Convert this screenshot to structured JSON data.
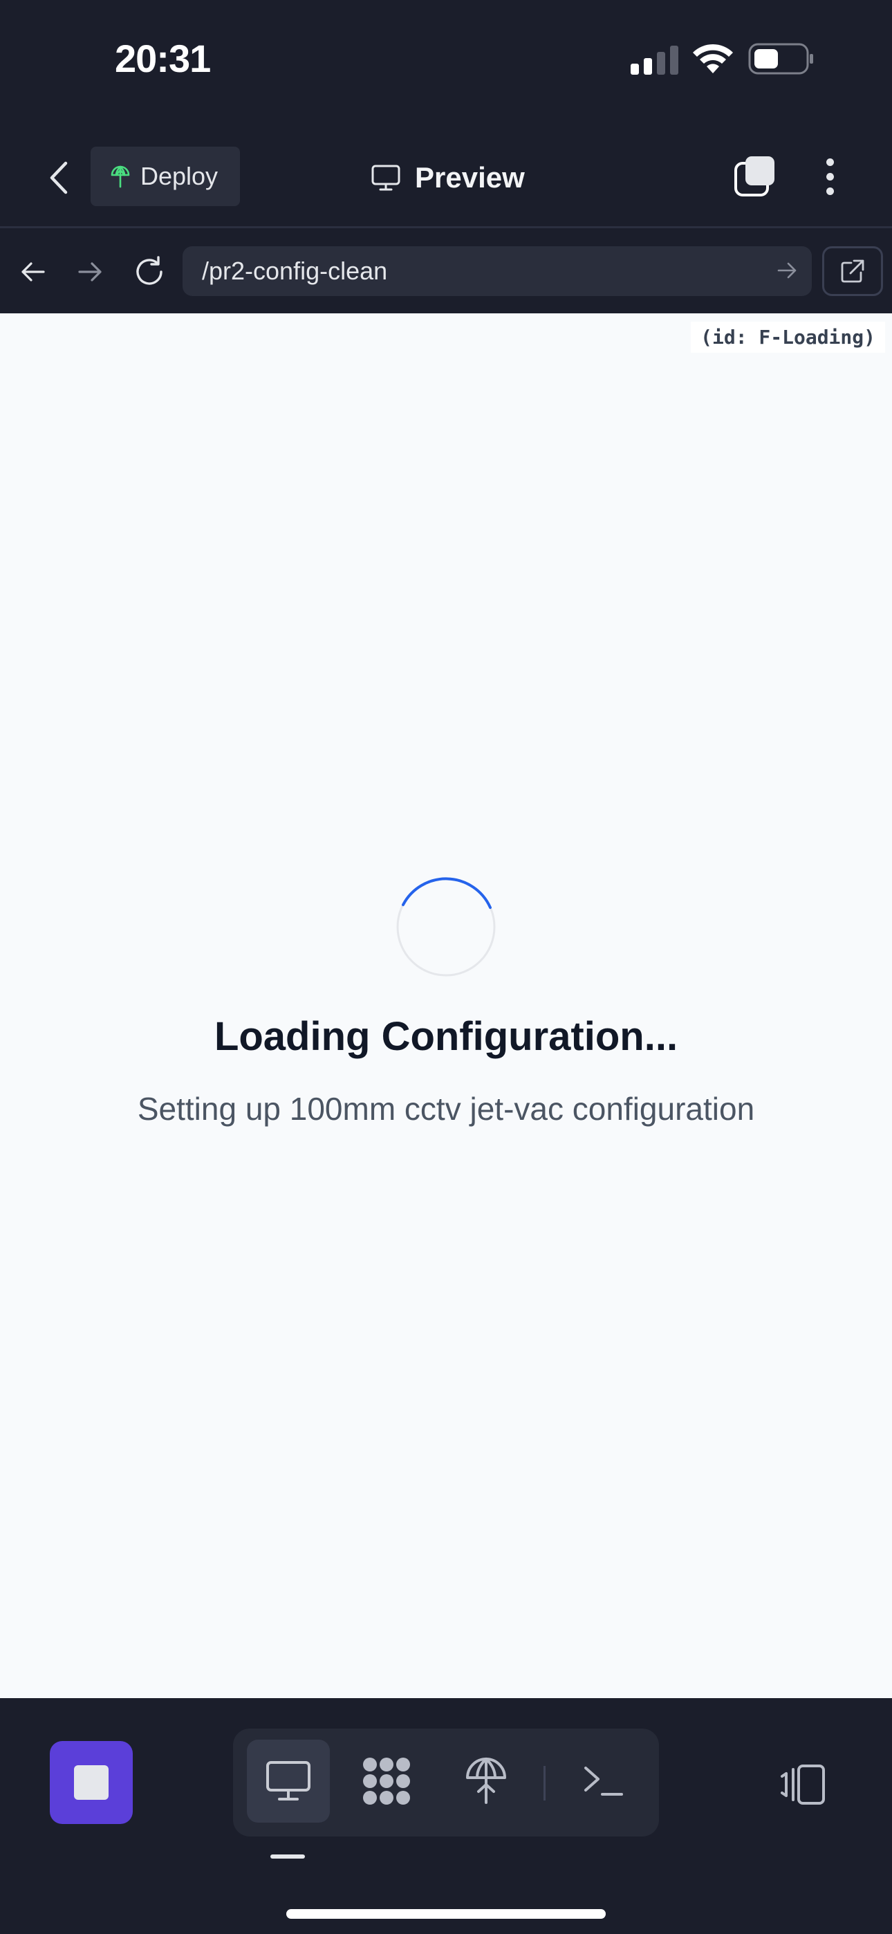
{
  "status_bar": {
    "time": "20:31",
    "icons": [
      "signal-icon",
      "wifi-icon",
      "battery-icon"
    ]
  },
  "header": {
    "back_icon": "chevron-left-icon",
    "deploy_label": "Deploy",
    "deploy_icon": "deploy-umbrella-icon",
    "preview_label": "Preview",
    "preview_icon": "monitor-icon",
    "tabs_icon": "tabs-icon",
    "more_icon": "more-vertical-icon"
  },
  "browser": {
    "url": "/pr2-config-clean",
    "back_icon": "arrow-left-icon",
    "forward_icon": "arrow-right-icon",
    "reload_icon": "reload-icon",
    "go_icon": "arrow-right-icon",
    "open_external_icon": "external-link-icon"
  },
  "content": {
    "id_tag": "(id: F-Loading)",
    "loading_title": "Loading Configuration...",
    "loading_subtitle": "Setting up 100mm cctv jet-vac configuration",
    "spinner_color": "#2563eb",
    "background": "#f8fafc"
  },
  "bottom_bar": {
    "stop_icon": "stop-icon",
    "stop_color": "#5b3fd9",
    "tools": [
      {
        "icon": "monitor-icon",
        "active": true
      },
      {
        "icon": "agent-dots-icon",
        "active": false
      },
      {
        "icon": "deploy-umbrella-icon",
        "active": false
      },
      {
        "icon": "terminal-icon",
        "active": false
      }
    ],
    "device_icon": "device-toggle-icon"
  }
}
